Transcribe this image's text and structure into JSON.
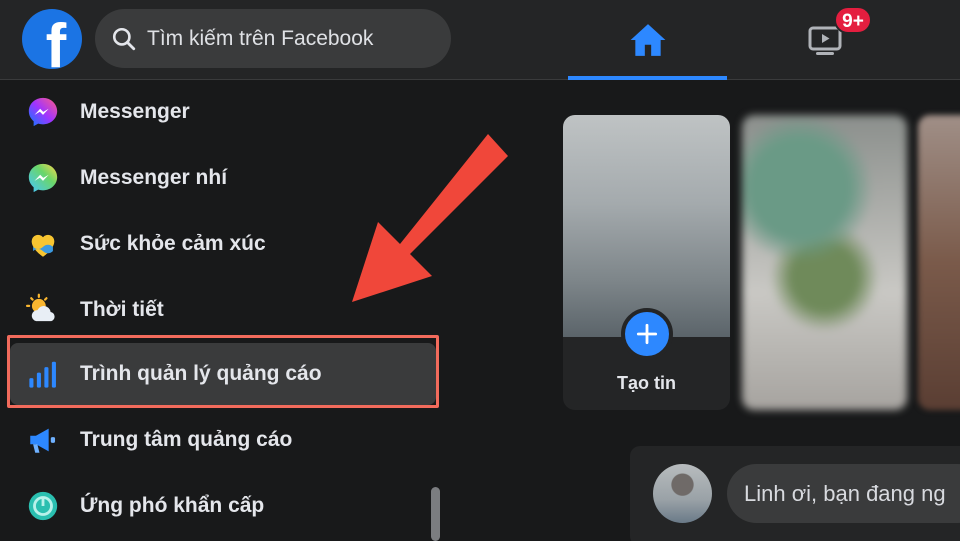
{
  "header": {
    "logo_letter": "f",
    "search": {
      "placeholder": "Tìm kiếm trên Facebook"
    },
    "nav": {
      "home_icon": "home-icon",
      "watch_icon": "watch-icon",
      "watch_badge": "9+"
    }
  },
  "sidebar": {
    "items": [
      {
        "label": "Messenger",
        "icon": "messenger-icon"
      },
      {
        "label": "Messenger nhí",
        "icon": "messenger-kids-icon"
      },
      {
        "label": "Sức khỏe cảm xúc",
        "icon": "emotional-health-icon"
      },
      {
        "label": "Thời tiết",
        "icon": "weather-icon"
      },
      {
        "label": "Trình quản lý quảng cáo",
        "icon": "ads-manager-icon",
        "highlighted": true
      },
      {
        "label": "Trung tâm quảng cáo",
        "icon": "megaphone-icon"
      },
      {
        "label": "Ứng phó khẩn cấp",
        "icon": "crisis-response-icon"
      }
    ]
  },
  "stories": {
    "create_label": "Tạo tin"
  },
  "composer": {
    "prompt": "Linh ơi, bạn đang ng"
  },
  "colors": {
    "accent": "#2d88ff",
    "badge": "#e41e3f",
    "annotation_red": "#f0473a"
  }
}
